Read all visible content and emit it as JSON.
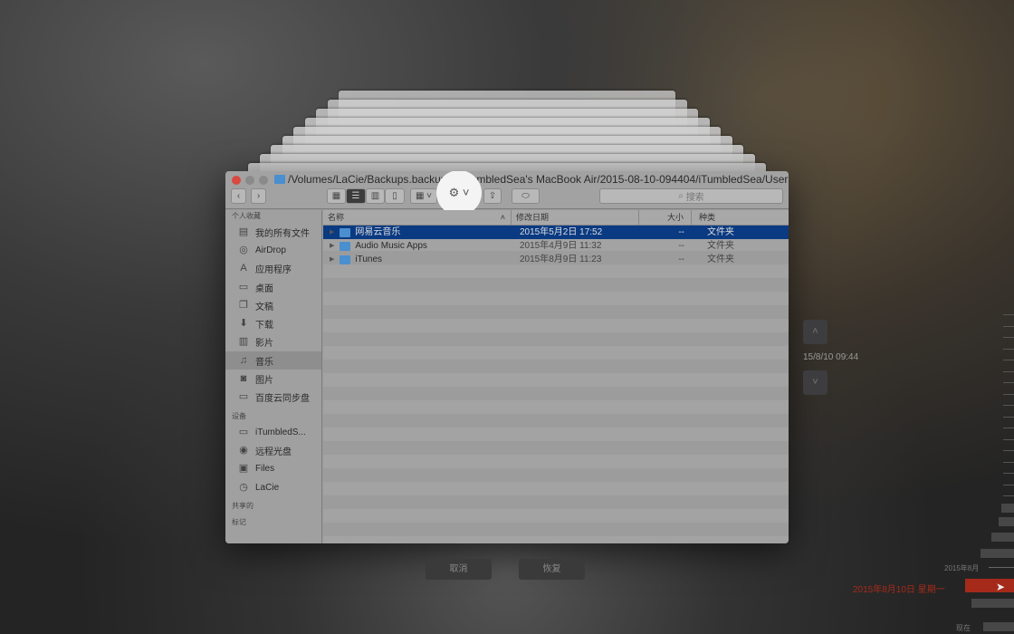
{
  "window": {
    "path": "/Volumes/LaCie/Backups.backupdb/iTumbledSea's MacBook Air/2015-08-10-094404/iTumbledSea/Users/iTum...",
    "search_placeholder": "搜索"
  },
  "sidebar": {
    "sections": [
      {
        "title": "个人收藏",
        "items": [
          {
            "label": "我的所有文件",
            "icon": "all-files-icon"
          },
          {
            "label": "AirDrop",
            "icon": "airdrop-icon"
          },
          {
            "label": "应用程序",
            "icon": "applications-icon"
          },
          {
            "label": "桌面",
            "icon": "desktop-icon"
          },
          {
            "label": "文稿",
            "icon": "documents-icon"
          },
          {
            "label": "下载",
            "icon": "download-icon"
          },
          {
            "label": "影片",
            "icon": "movies-icon"
          },
          {
            "label": "音乐",
            "icon": "music-icon",
            "selected": true
          },
          {
            "label": "图片",
            "icon": "camera-icon"
          },
          {
            "label": "百度云同步盘",
            "icon": "folder-icon"
          }
        ]
      },
      {
        "title": "设备",
        "items": [
          {
            "label": "iTumbledS...",
            "icon": "laptop-icon"
          },
          {
            "label": "远程光盘",
            "icon": "disc-icon"
          },
          {
            "label": "Files",
            "icon": "disk-icon"
          },
          {
            "label": "LaCie",
            "icon": "time-machine-disk-icon"
          }
        ]
      },
      {
        "title": "共享的",
        "items": []
      },
      {
        "title": "标记",
        "items": []
      }
    ]
  },
  "columns": {
    "name": "名称",
    "date": "修改日期",
    "size": "大小",
    "kind": "种类"
  },
  "rows": [
    {
      "name": "网易云音乐",
      "date": "2015年5月2日 17:52",
      "size": "--",
      "kind": "文件夹",
      "selected": true
    },
    {
      "name": "Audio Music Apps",
      "date": "2015年4月9日 11:32",
      "size": "--",
      "kind": "文件夹"
    },
    {
      "name": "iTunes",
      "date": "2015年8月9日 11:23",
      "size": "--",
      "kind": "文件夹"
    }
  ],
  "buttons": {
    "cancel": "取消",
    "restore": "恢复"
  },
  "timemachine": {
    "current": "15/8/10 09:44",
    "month_label": "2015年8月",
    "selected_date": "2015年8月10日 星期一",
    "now_label": "现在"
  },
  "colors": {
    "selection": "#0a3a82",
    "timeline_accent": "#a52a1a"
  }
}
